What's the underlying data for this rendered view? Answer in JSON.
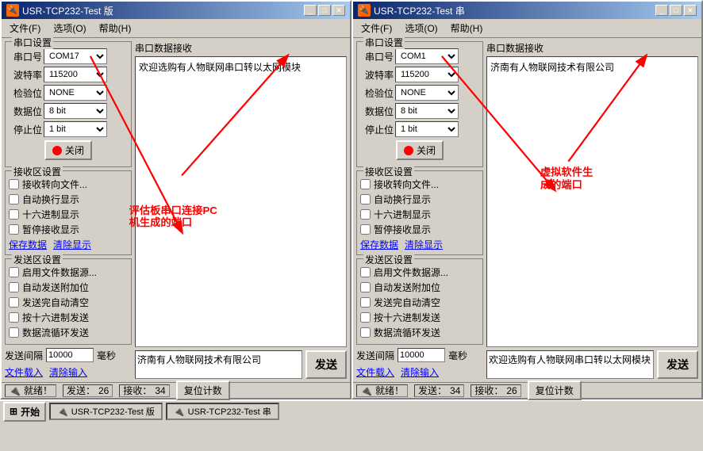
{
  "window1": {
    "title": "USR-TCP232-Test 版",
    "menu": [
      "文件(F)",
      "选项(O)",
      "帮助(H)"
    ],
    "serial_settings": {
      "label": "串口设置",
      "port_label": "串口号",
      "port_value": "COM17",
      "baud_label": "波特率",
      "baud_value": "115200",
      "check_label": "检验位",
      "check_value": "NONE",
      "data_label": "数据位",
      "data_value": "8 bit",
      "stop_label": "停止位",
      "stop_value": "1 bit",
      "close_btn": "关闭"
    },
    "recv_settings": {
      "label": "接收区设置",
      "cb1": "接收转向文件...",
      "cb2": "自动换行显示",
      "cb3": "十六进制显示",
      "cb4": "暂停接收显示",
      "save_link": "保存数据",
      "clear_link": "清除显示"
    },
    "send_settings": {
      "label": "发送区设置",
      "cb1": "启用文件数据源...",
      "cb2": "自动发送附加位",
      "cb3": "发送完自动清空",
      "cb4": "按十六进制发送",
      "cb5": "数据流循环发送",
      "interval_label": "发送间隔",
      "interval_value": "10000",
      "interval_unit": "毫秒",
      "load_link": "文件载入",
      "clear_link": "清除输入"
    },
    "recv_area": {
      "title": "串口数据接收",
      "content": "欢迎选购有人物联网串口转以太网模块"
    },
    "send_area": {
      "content": "济南有人物联网技术有限公司"
    },
    "send_btn": "发送",
    "status": {
      "ready": "就绪！",
      "send_label": "发送：",
      "send_count": "26",
      "recv_label": "接收：",
      "recv_count": "34",
      "reset_btn": "复位计数"
    }
  },
  "window2": {
    "title": "USR-TCP232-Test 串",
    "menu": [
      "文件(F)",
      "选项(O)",
      "帮助(H)"
    ],
    "serial_settings": {
      "label": "串口设置",
      "port_label": "串口号",
      "port_value": "COM1",
      "baud_label": "波特率",
      "baud_value": "115200",
      "check_label": "检验位",
      "check_value": "NONE",
      "data_label": "数据位",
      "data_value": "8 bit",
      "stop_label": "停止位",
      "stop_value": "1 bit",
      "close_btn": "关闭"
    },
    "recv_settings": {
      "label": "接收区设置",
      "cb1": "接收转向文件...",
      "cb2": "自动换行显示",
      "cb3": "十六进制显示",
      "cb4": "暂停接收显示",
      "save_link": "保存数据",
      "clear_link": "清除显示"
    },
    "send_settings": {
      "label": "发送区设置",
      "cb1": "启用文件数据源...",
      "cb2": "自动发送附加位",
      "cb3": "发送完自动清空",
      "cb4": "按十六进制发送",
      "cb5": "数据流循环发送",
      "interval_label": "发送间隔",
      "interval_value": "10000",
      "interval_unit": "毫秒",
      "load_link": "文件载入",
      "clear_link": "清除输入"
    },
    "recv_area": {
      "title": "串口数据接收",
      "content": "济南有人物联网技术有限公司"
    },
    "send_area": {
      "content": "欢迎选购有人物联网串口转以太网模块"
    },
    "send_btn": "发送",
    "status": {
      "ready": "就绪！",
      "send_label": "发送：",
      "send_count": "34",
      "recv_label": "接收：",
      "recv_count": "26",
      "reset_btn": "复位计数"
    }
  },
  "annotation1": {
    "text": "评估板串口连接PC\n机生成的端口",
    "arrow_from": "COM17",
    "arrow_to": "COM17_label"
  },
  "annotation2": {
    "text": "虚拟软件生\n成的端口",
    "arrow_from": "COM1",
    "arrow_to": "COM1_label"
  },
  "taskbar": {
    "window1_label": "USR-TCP232-Test 版",
    "window2_label": "USR-TCP232-Test 串"
  }
}
